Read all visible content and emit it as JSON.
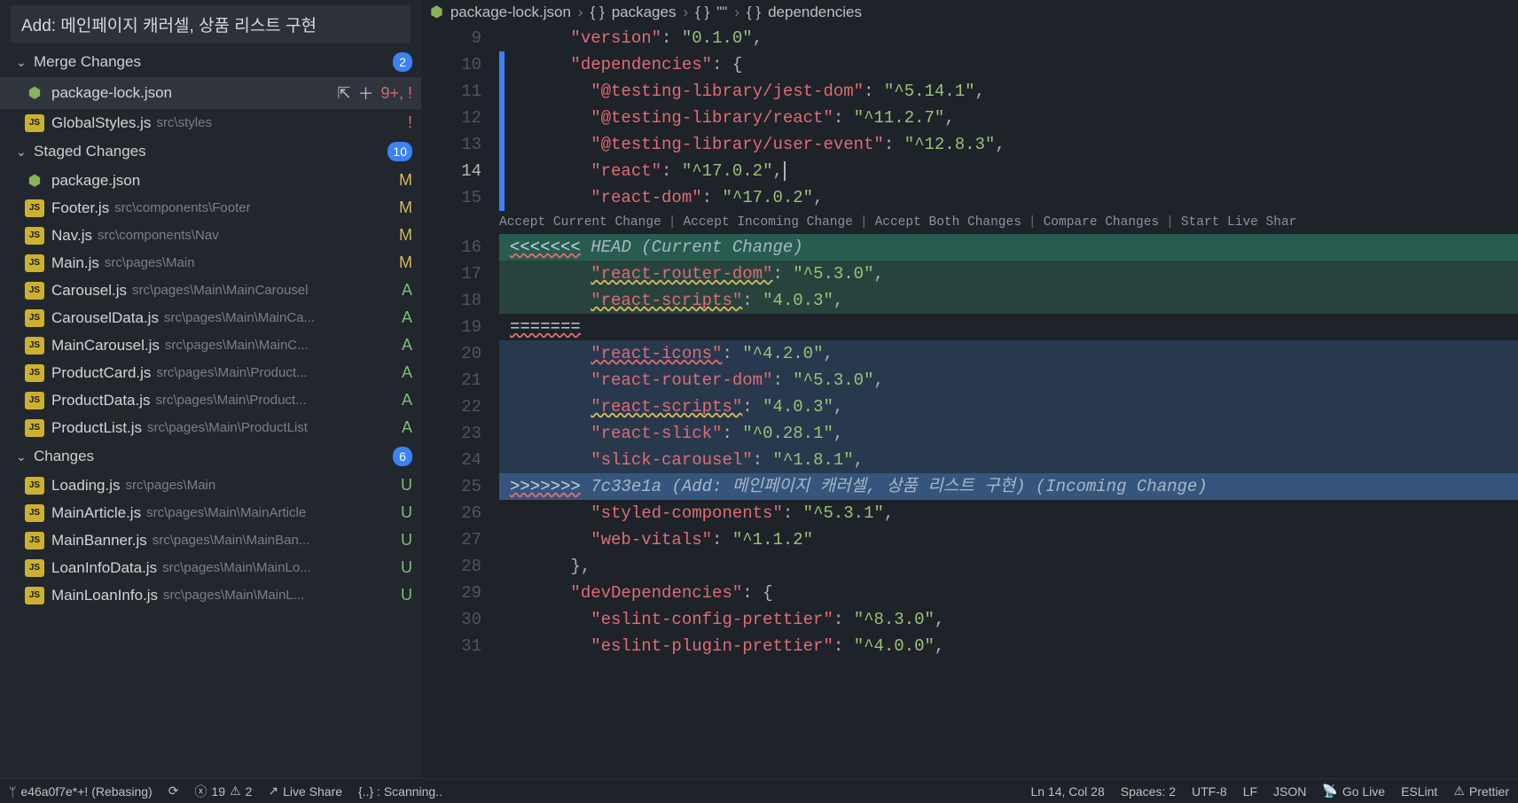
{
  "commit_message": "Add: 메인페이지 캐러셀, 상품 리스트 구현",
  "sections": {
    "merge": {
      "label": "Merge Changes",
      "count": "2"
    },
    "staged": {
      "label": "Staged Changes",
      "count": "10"
    },
    "changes": {
      "label": "Changes",
      "count": "6"
    }
  },
  "merge_files": [
    {
      "icon": "json",
      "name": "package-lock.json",
      "path": "",
      "status": "9+, !",
      "status_class": "st-excl",
      "active": true,
      "actions": true
    },
    {
      "icon": "js",
      "name": "GlobalStyles.js",
      "path": "src\\styles",
      "status": "!",
      "status_class": "st-excl"
    }
  ],
  "staged_files": [
    {
      "icon": "json",
      "name": "package.json",
      "path": "",
      "status": "M",
      "status_class": "st-M"
    },
    {
      "icon": "js",
      "name": "Footer.js",
      "path": "src\\components\\Footer",
      "status": "M",
      "status_class": "st-M"
    },
    {
      "icon": "js",
      "name": "Nav.js",
      "path": "src\\components\\Nav",
      "status": "M",
      "status_class": "st-M"
    },
    {
      "icon": "js",
      "name": "Main.js",
      "path": "src\\pages\\Main",
      "status": "M",
      "status_class": "st-M"
    },
    {
      "icon": "js",
      "name": "Carousel.js",
      "path": "src\\pages\\Main\\MainCarousel",
      "status": "A",
      "status_class": "st-A"
    },
    {
      "icon": "js",
      "name": "CarouselData.js",
      "path": "src\\pages\\Main\\MainCa...",
      "status": "A",
      "status_class": "st-A"
    },
    {
      "icon": "js",
      "name": "MainCarousel.js",
      "path": "src\\pages\\Main\\MainC...",
      "status": "A",
      "status_class": "st-A"
    },
    {
      "icon": "js",
      "name": "ProductCard.js",
      "path": "src\\pages\\Main\\Product...",
      "status": "A",
      "status_class": "st-A"
    },
    {
      "icon": "js",
      "name": "ProductData.js",
      "path": "src\\pages\\Main\\Product...",
      "status": "A",
      "status_class": "st-A"
    },
    {
      "icon": "js",
      "name": "ProductList.js",
      "path": "src\\pages\\Main\\ProductList",
      "status": "A",
      "status_class": "st-A"
    }
  ],
  "changes_files": [
    {
      "icon": "js",
      "name": "Loading.js",
      "path": "src\\pages\\Main",
      "status": "U",
      "status_class": "st-U"
    },
    {
      "icon": "js",
      "name": "MainArticle.js",
      "path": "src\\pages\\Main\\MainArticle",
      "status": "U",
      "status_class": "st-U"
    },
    {
      "icon": "js",
      "name": "MainBanner.js",
      "path": "src\\pages\\Main\\MainBan...",
      "status": "U",
      "status_class": "st-U"
    },
    {
      "icon": "js",
      "name": "LoanInfoData.js",
      "path": "src\\pages\\Main\\MainLo...",
      "status": "U",
      "status_class": "st-U"
    },
    {
      "icon": "js",
      "name": "MainLoanInfo.js",
      "path": "src\\pages\\Main\\MainL...",
      "status": "U",
      "status_class": "st-U"
    }
  ],
  "breadcrumbs": {
    "file": "package-lock.json",
    "seg1": "packages",
    "seg2": "\"\"",
    "seg3": "dependencies"
  },
  "codelens": {
    "accept_current": "Accept Current Change",
    "accept_incoming": "Accept Incoming Change",
    "accept_both": "Accept Both Changes",
    "compare": "Compare Changes",
    "live_share": "Start Live Shar"
  },
  "code_lines": [
    {
      "n": "9",
      "html": "      <span class='tok-key'>\"version\"</span><span class='tok-punc'>:</span> <span class='tok-str'>\"0.1.0\"</span><span class='tok-punc'>,</span>"
    },
    {
      "n": "10",
      "html": "      <span class='tok-key'>\"dependencies\"</span><span class='tok-punc'>:</span> <span class='tok-punc'>{</span>",
      "marker": "blue"
    },
    {
      "n": "11",
      "html": "        <span class='tok-key'>\"@testing-library/jest-dom\"</span><span class='tok-punc'>:</span> <span class='tok-str'>\"^5.14.1\"</span><span class='tok-punc'>,</span>",
      "marker": "blue"
    },
    {
      "n": "12",
      "html": "        <span class='tok-key'>\"@testing-library/react\"</span><span class='tok-punc'>:</span> <span class='tok-str'>\"^11.2.7\"</span><span class='tok-punc'>,</span>",
      "marker": "blue"
    },
    {
      "n": "13",
      "html": "        <span class='tok-key'>\"@testing-library/user-event\"</span><span class='tok-punc'>:</span> <span class='tok-str'>\"^12.8.3\"</span><span class='tok-punc'>,</span>",
      "marker": "blue"
    },
    {
      "n": "14",
      "html": "        <span class='tok-key'>\"react\"</span><span class='tok-punc'>:</span> <span class='tok-str'>\"^17.0.2\"</span><span class='tok-punc'>,</span><span class='cursor'></span>",
      "marker": "blue",
      "active": true
    },
    {
      "n": "15",
      "html": "        <span class='tok-key'>\"react-dom\"</span><span class='tok-punc'>:</span> <span class='tok-str'>\"^17.0.2\"</span><span class='tok-punc'>,</span>",
      "marker": "blue"
    },
    {
      "n": "",
      "codelens": true
    },
    {
      "n": "16",
      "html": "<span class='tok-merge-strong underline-err'>&lt;&lt;&lt;&lt;&lt;&lt;&lt;</span> <span class='tok-merge'>HEAD (Current Change)</span>",
      "bg": "bg-current-hdr"
    },
    {
      "n": "17",
      "html": "        <span class='tok-key underline-warn'>\"react-router-dom\"</span><span class='tok-punc'>:</span> <span class='tok-str'>\"^5.3.0\"</span><span class='tok-punc'>,</span>",
      "bg": "bg-current"
    },
    {
      "n": "18",
      "html": "        <span class='tok-key underline-warn'>\"react-scripts\"</span><span class='tok-punc'>:</span> <span class='tok-str'>\"4.0.3\"</span><span class='tok-punc'>,</span>",
      "bg": "bg-current"
    },
    {
      "n": "19",
      "html": "<span class='tok-merge-strong underline-err'>=======</span>"
    },
    {
      "n": "20",
      "html": "        <span class='tok-key underline-err'>\"react-icons\"</span><span class='tok-punc'>:</span> <span class='tok-str'>\"^4.2.0\"</span><span class='tok-punc'>,</span>",
      "bg": "bg-incoming"
    },
    {
      "n": "21",
      "html": "        <span class='tok-key'>\"react-router-dom\"</span><span class='tok-punc'>:</span> <span class='tok-str'>\"^5.3.0\"</span><span class='tok-punc'>,</span>",
      "bg": "bg-incoming"
    },
    {
      "n": "22",
      "html": "        <span class='tok-key underline-warn'>\"react-scripts\"</span><span class='tok-punc'>:</span> <span class='tok-str'>\"4.0.3\"</span><span class='tok-punc'>,</span>",
      "bg": "bg-incoming"
    },
    {
      "n": "23",
      "html": "        <span class='tok-key'>\"react-slick\"</span><span class='tok-punc'>:</span> <span class='tok-str'>\"^0.28.1\"</span><span class='tok-punc'>,</span>",
      "bg": "bg-incoming"
    },
    {
      "n": "24",
      "html": "        <span class='tok-key'>\"slick-carousel\"</span><span class='tok-punc'>:</span> <span class='tok-str'>\"^1.8.1\"</span><span class='tok-punc'>,</span>",
      "bg": "bg-incoming"
    },
    {
      "n": "25",
      "html": "<span class='tok-merge-strong underline-err'>&gt;&gt;&gt;&gt;&gt;&gt;&gt;</span> <span class='tok-merge'>7c33e1a (Add: 메인페이지 캐러셀, 상품 리스트 구현) (Incoming Change)</span>",
      "bg": "bg-incoming-hdr"
    },
    {
      "n": "26",
      "html": "        <span class='tok-key'>\"styled-components\"</span><span class='tok-punc'>:</span> <span class='tok-str'>\"^5.3.1\"</span><span class='tok-punc'>,</span>"
    },
    {
      "n": "27",
      "html": "        <span class='tok-key'>\"web-vitals\"</span><span class='tok-punc'>:</span> <span class='tok-str'>\"^1.1.2\"</span>"
    },
    {
      "n": "28",
      "html": "      <span class='tok-punc'>},</span>"
    },
    {
      "n": "29",
      "html": "      <span class='tok-key'>\"devDependencies\"</span><span class='tok-punc'>:</span> <span class='tok-punc'>{</span>"
    },
    {
      "n": "30",
      "html": "        <span class='tok-key'>\"eslint-config-prettier\"</span><span class='tok-punc'>:</span> <span class='tok-str'>\"^8.3.0\"</span><span class='tok-punc'>,</span>"
    },
    {
      "n": "31",
      "html": "        <span class='tok-key'>\"eslint-plugin-prettier\"</span><span class='tok-punc'>:</span> <span class='tok-str'>\"^4.0.0\"</span><span class='tok-punc'>,</span>"
    }
  ],
  "statusbar": {
    "branch": "e46a0f7e*+! (Rebasing)",
    "errors": "19",
    "warnings": "2",
    "live_share": "Live Share",
    "scanning": "{..} : Scanning..",
    "cursor": "Ln 14, Col 28",
    "spaces": "Spaces: 2",
    "encoding": "UTF-8",
    "eol": "LF",
    "lang": "JSON",
    "golive": "Go Live",
    "eslint": "ESLint",
    "prettier": "Prettier"
  }
}
